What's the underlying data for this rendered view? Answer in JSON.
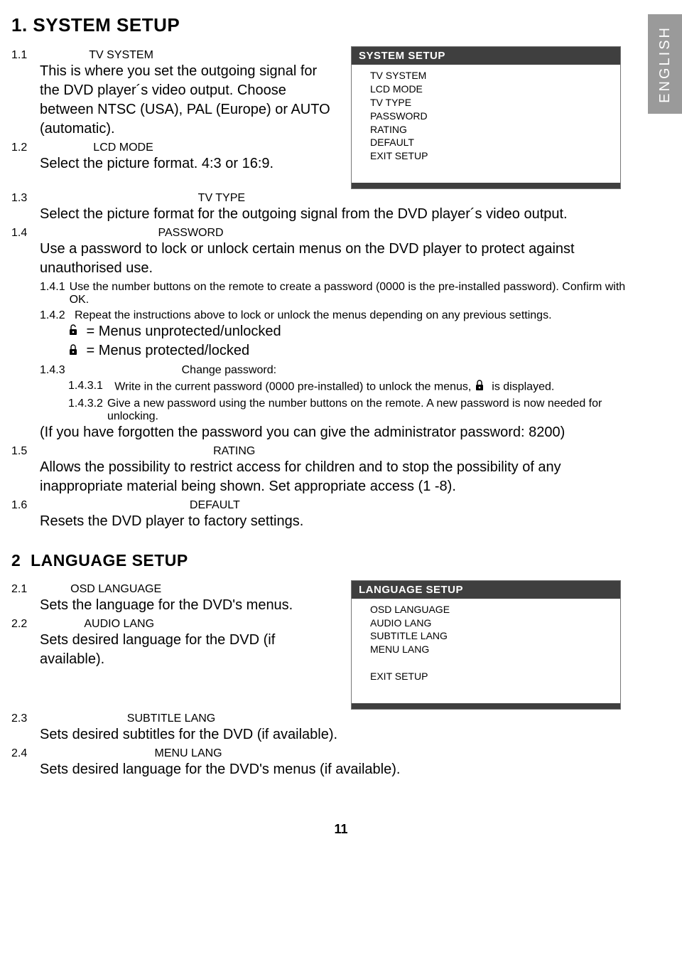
{
  "side_tab": "ENGLISH",
  "page_number": "11",
  "section1": {
    "title": "1. SYSTEM SETUP",
    "items": {
      "s11_num": "1.1",
      "s11_label": "TV SYSTEM",
      "s11_body": "This is where you set the outgoing signal for the DVD player´s video output. Choose between NTSC (USA), PAL (Europe) or AUTO (automatic).",
      "s12_num": "1.2",
      "s12_label": "LCD MODE",
      "s12_body": "Select the picture format. 4:3 or 16:9.",
      "s13_num": "1.3",
      "s13_label": "TV TYPE",
      "s13_body": "Select the picture format for the outgoing signal from the DVD player´s video output.",
      "s14_num": "1.4",
      "s14_label": "PASSWORD",
      "s14_body": "Use a password to lock or unlock certain menus on the DVD player to protect against unauthorised use.",
      "s141_num": "1.4.1",
      "s141_body": "Use the number buttons on the remote to create a password (0000 is the pre-installed password). Confirm with OK.",
      "s142_num": "1.4.2",
      "s142_body": "Repeat the instructions above to lock or unlock the menus depending on any previous settings.",
      "s142_unlocked": " = Menus unprotected/unlocked",
      "s142_locked": " = Menus protected/locked",
      "s143_num": "1.4.3",
      "s143_label": "Change password:",
      "s1431_num": "1.4.3.1",
      "s1431_a": "Write in the current password (0000 pre-installed) to unlock the menus, ",
      "s1431_b": "  is displayed.",
      "s1432_num": "1.4.3.2",
      "s1432_body": "Give a new password using the number buttons on the remote. A new password is now needed for unlocking.",
      "s14_note": "(If you have forgotten the password you can give the administrator password: 8200)",
      "s15_num": "1.5",
      "s15_label": "RATING",
      "s15_body": "Allows the possibility to restrict access for children and to stop the possibility of any inappropriate material being shown. Set appropriate access (1 -8).",
      "s16_num": "1.6",
      "s16_label": "DEFAULT",
      "s16_body": "Resets the DVD player to factory settings."
    },
    "menu": {
      "header": "SYSTEM SETUP",
      "items": [
        "TV SYSTEM",
        "LCD MODE",
        "TV TYPE",
        "PASSWORD",
        "RATING",
        "DEFAULT",
        "EXIT SETUP"
      ]
    }
  },
  "section2": {
    "title_num": "2",
    "title_label": "LANGUAGE SETUP",
    "items": {
      "s21_num": "2.1",
      "s21_label": "OSD LANGUAGE",
      "s21_body": "Sets the language for the DVD's menus.",
      "s22_num": "2.2",
      "s22_label": "AUDIO LANG",
      "s22_body": "Sets desired language for the DVD (if available).",
      "s23_num": "2.3",
      "s23_label": "SUBTITLE LANG",
      "s23_body": "Sets desired subtitles for the DVD (if available).",
      "s24_num": "2.4",
      "s24_label": "MENU LANG",
      "s24_body": "Sets desired language for the DVD's menus (if available)."
    },
    "menu": {
      "header": "LANGUAGE SETUP",
      "items": [
        "OSD LANGUAGE",
        "AUDIO LANG",
        "SUBTITLE LANG",
        "MENU LANG",
        "",
        "EXIT SETUP"
      ]
    }
  }
}
